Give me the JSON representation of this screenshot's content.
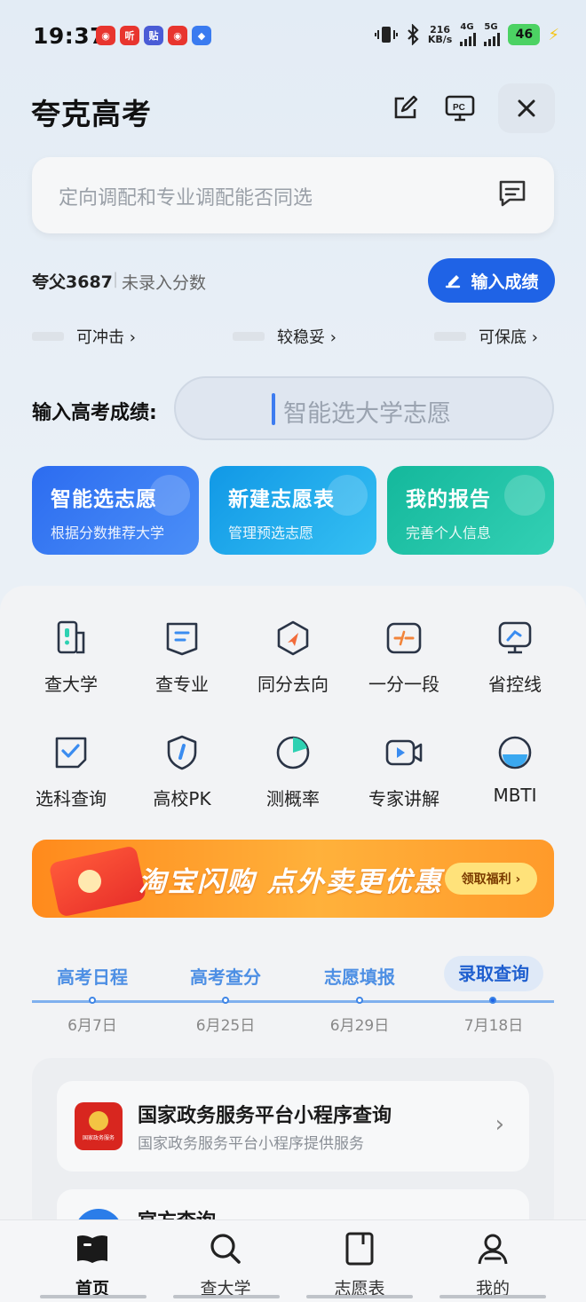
{
  "status_bar": {
    "time": "19:37",
    "apps": [
      {
        "name": "netease-music-icon",
        "glyph": "◉",
        "color": "#e8352e"
      },
      {
        "name": "listen-icon",
        "glyph": "听",
        "color": "#e8352e"
      },
      {
        "name": "tieba-icon",
        "glyph": "贴",
        "color": "#4a5cd6"
      },
      {
        "name": "netease-music-icon-2",
        "glyph": "◉",
        "color": "#e8352e"
      },
      {
        "name": "cloud-app-icon",
        "glyph": "◆",
        "color": "#3a7bf0"
      }
    ],
    "net_speed_value": "216",
    "net_speed_unit": "KB/s",
    "net_type_1": "4G",
    "net_type_2": "5G",
    "battery": "46"
  },
  "header": {
    "title": "夸克高考"
  },
  "search": {
    "placeholder": "定向调配和专业调配能否同选"
  },
  "user": {
    "name": "夸父3687",
    "separator": "|",
    "score_status": "未录入分数",
    "score_button": "输入成绩"
  },
  "categories": [
    {
      "label": "可冲击 ›"
    },
    {
      "label": "较稳妥 ›"
    },
    {
      "label": "可保底 ›"
    }
  ],
  "score_entry": {
    "label": "输入高考成绩:",
    "placeholder": "智能选大学志愿"
  },
  "cards": [
    {
      "title": "智能选志愿",
      "subtitle": "根据分数推荐大学",
      "color": "#2f6ff0"
    },
    {
      "title": "新建志愿表",
      "subtitle": "管理预选志愿",
      "color": "#1aa6e8"
    },
    {
      "title": "我的报告",
      "subtitle": "完善个人信息",
      "color": "#1dc3a6"
    }
  ],
  "grid": [
    {
      "label": "查大学",
      "icon": "university-icon"
    },
    {
      "label": "查专业",
      "icon": "major-icon"
    },
    {
      "label": "同分去向",
      "icon": "same-score-icon"
    },
    {
      "label": "一分一段",
      "icon": "score-segment-icon"
    },
    {
      "label": "省控线",
      "icon": "control-line-icon"
    },
    {
      "label": "选科查询",
      "icon": "subject-check-icon"
    },
    {
      "label": "高校PK",
      "icon": "college-pk-icon"
    },
    {
      "label": "测概率",
      "icon": "probability-icon"
    },
    {
      "label": "专家讲解",
      "icon": "expert-video-icon"
    },
    {
      "label": "MBTI",
      "icon": "mbti-icon"
    }
  ],
  "banner": {
    "text": "淘宝闪购 点外卖更优惠",
    "button": "领取福利 ›"
  },
  "timeline": {
    "tabs": [
      {
        "label": "高考日程",
        "date": "6月7日"
      },
      {
        "label": "高考查分",
        "date": "6月25日"
      },
      {
        "label": "志愿填报",
        "date": "6月29日"
      },
      {
        "label": "录取查询",
        "date": "7月18日"
      }
    ],
    "active_index": 3
  },
  "results": [
    {
      "title": "国家政务服务平台小程序查询",
      "subtitle": "国家政务服务平台小程序提供服务",
      "logo_text": "国家政务服务"
    },
    {
      "title": "官方查询"
    }
  ],
  "bottom_nav": [
    {
      "label": "首页",
      "icon": "home-book-icon",
      "active": true
    },
    {
      "label": "查大学",
      "icon": "search-icon",
      "active": false
    },
    {
      "label": "志愿表",
      "icon": "form-icon",
      "active": false
    },
    {
      "label": "我的",
      "icon": "profile-icon",
      "active": false
    }
  ]
}
